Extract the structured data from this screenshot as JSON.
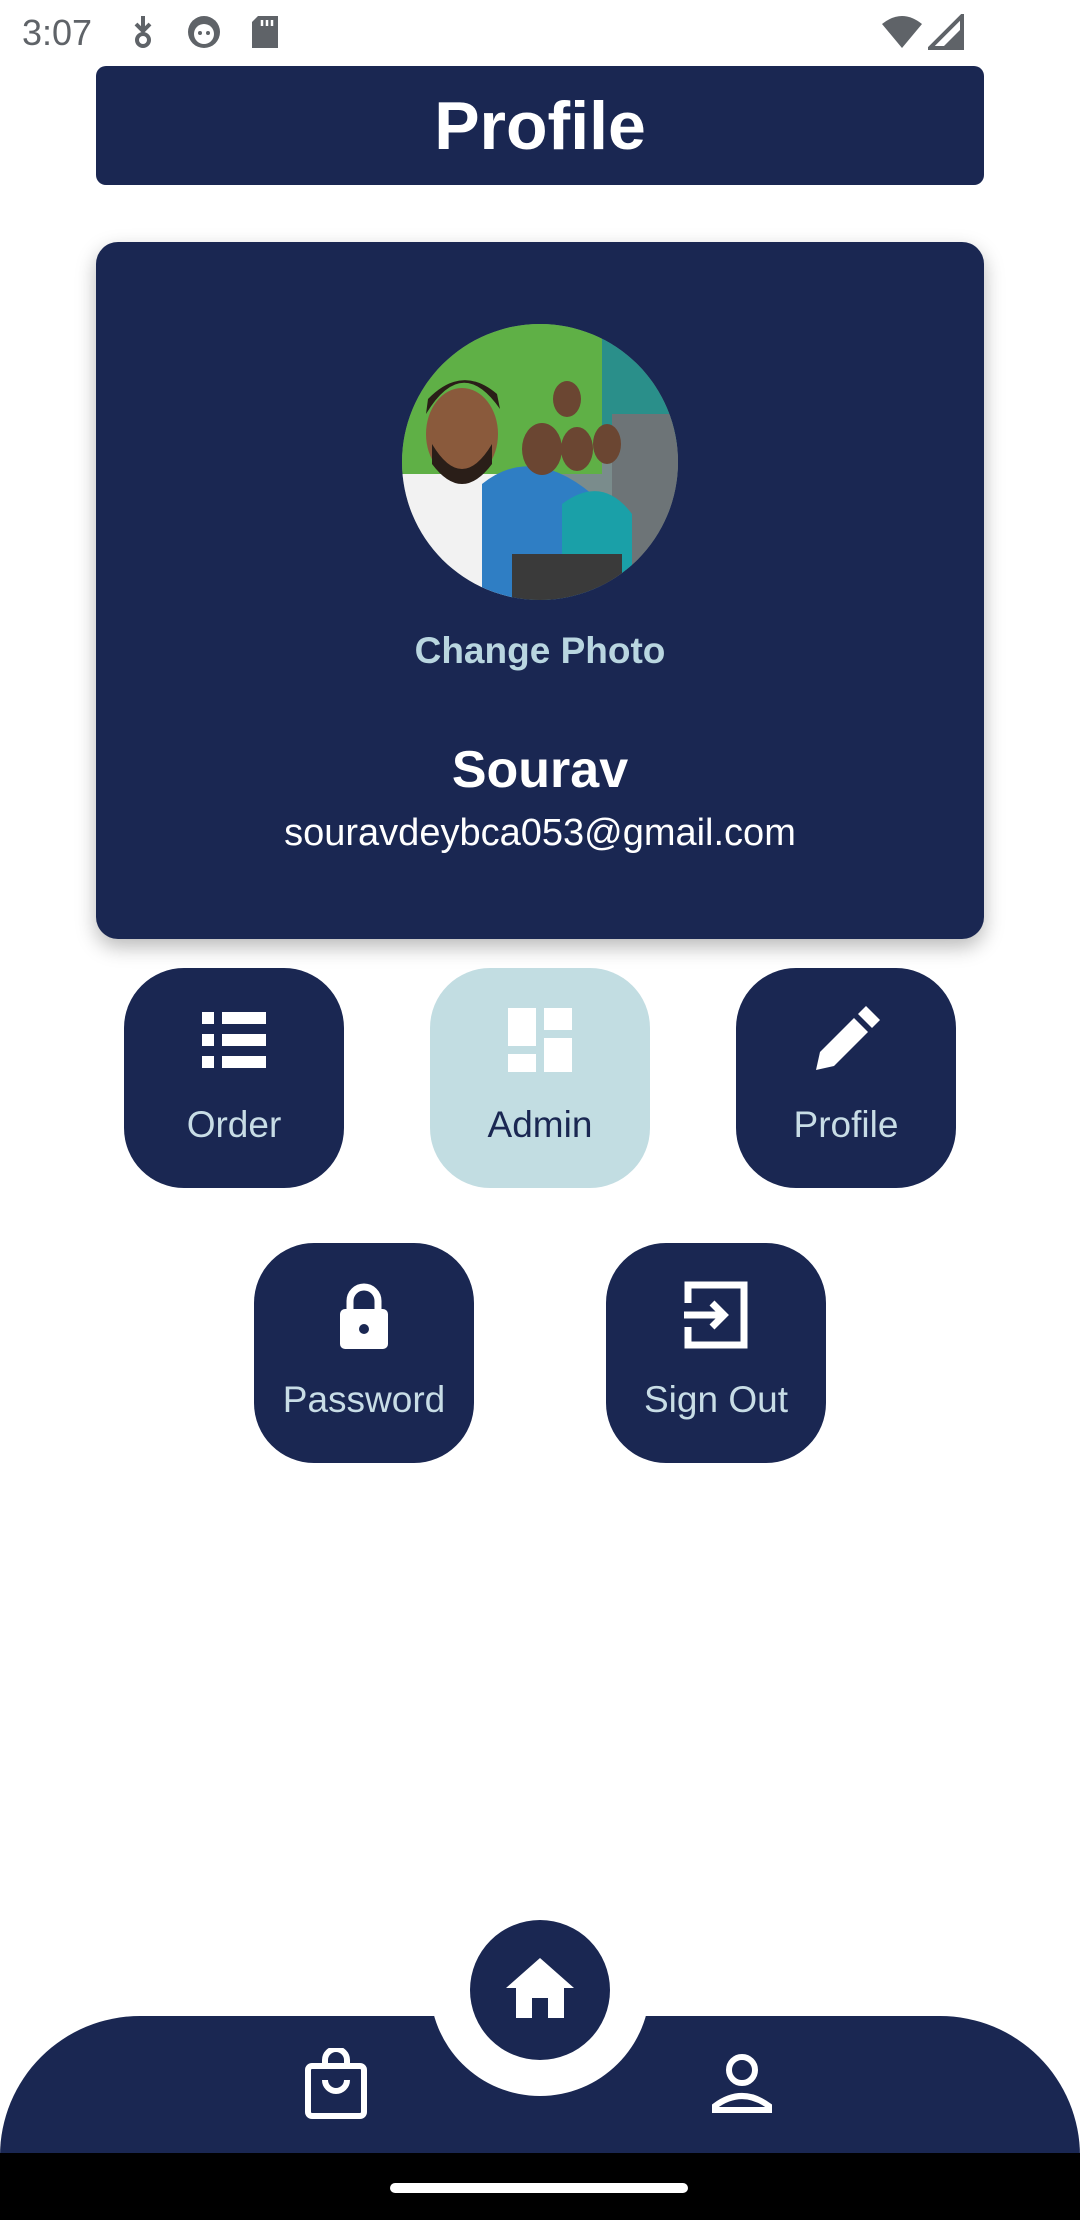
{
  "status_bar": {
    "time": "3:07"
  },
  "header": {
    "title": "Profile"
  },
  "profile": {
    "change_photo_label": "Change Photo",
    "name": "Sourav",
    "email": "souravdeybca053@gmail.com"
  },
  "actions": [
    {
      "label": "Order",
      "icon": "list-icon"
    },
    {
      "label": "Admin",
      "icon": "dashboard-icon",
      "highlighted": true
    },
    {
      "label": "Profile",
      "icon": "edit-pencil-icon"
    },
    {
      "label": "Password",
      "icon": "lock-icon"
    },
    {
      "label": "Sign Out",
      "icon": "sign-out-icon"
    }
  ],
  "bottom_nav": {
    "items": [
      {
        "icon": "shopping-bag-icon"
      },
      {
        "icon": "home-icon",
        "active": true
      },
      {
        "icon": "person-icon"
      }
    ]
  },
  "colors": {
    "primary": "#1a2752",
    "accent_light": "#c2dde2",
    "label_light": "#b9d6e0"
  }
}
